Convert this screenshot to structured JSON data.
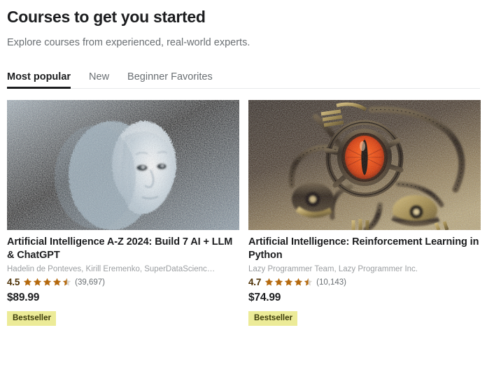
{
  "header": {
    "title": "Courses to get you started",
    "subtitle": "Explore courses from experienced, real-world experts."
  },
  "tabs": [
    {
      "label": "Most popular",
      "active": true
    },
    {
      "label": "New",
      "active": false
    },
    {
      "label": "Beginner Favorites",
      "active": false
    }
  ],
  "courses": [
    {
      "title": "Artificial Intelligence A-Z 2024: Build 7 AI + LLM & ChatGPT",
      "instructors": "Hadelin de Ponteves, Kirill Eremenko, SuperDataScienc…",
      "rating": "4.5",
      "rating_value": 4.5,
      "rating_count": "(39,697)",
      "price": "$89.99",
      "badge": "Bestseller",
      "image_alt": "pixelated-humanoid-face-image"
    },
    {
      "title": "Artificial Intelligence: Reinforcement Learning in Python",
      "instructors": "Lazy Programmer Team, Lazy Programmer Inc.",
      "rating": "4.7",
      "rating_value": 4.7,
      "rating_count": "(10,143)",
      "price": "$74.99",
      "badge": "Bestseller",
      "image_alt": "steampunk-mechanical-red-eye-image"
    }
  ],
  "colors": {
    "star": "#b4690e",
    "star_empty": "#d9d5cf",
    "badge_bg": "#eceb98",
    "text_primary": "#1c1d1f",
    "text_muted": "#6a6f73",
    "tab_underline": "#1c1d1f"
  }
}
